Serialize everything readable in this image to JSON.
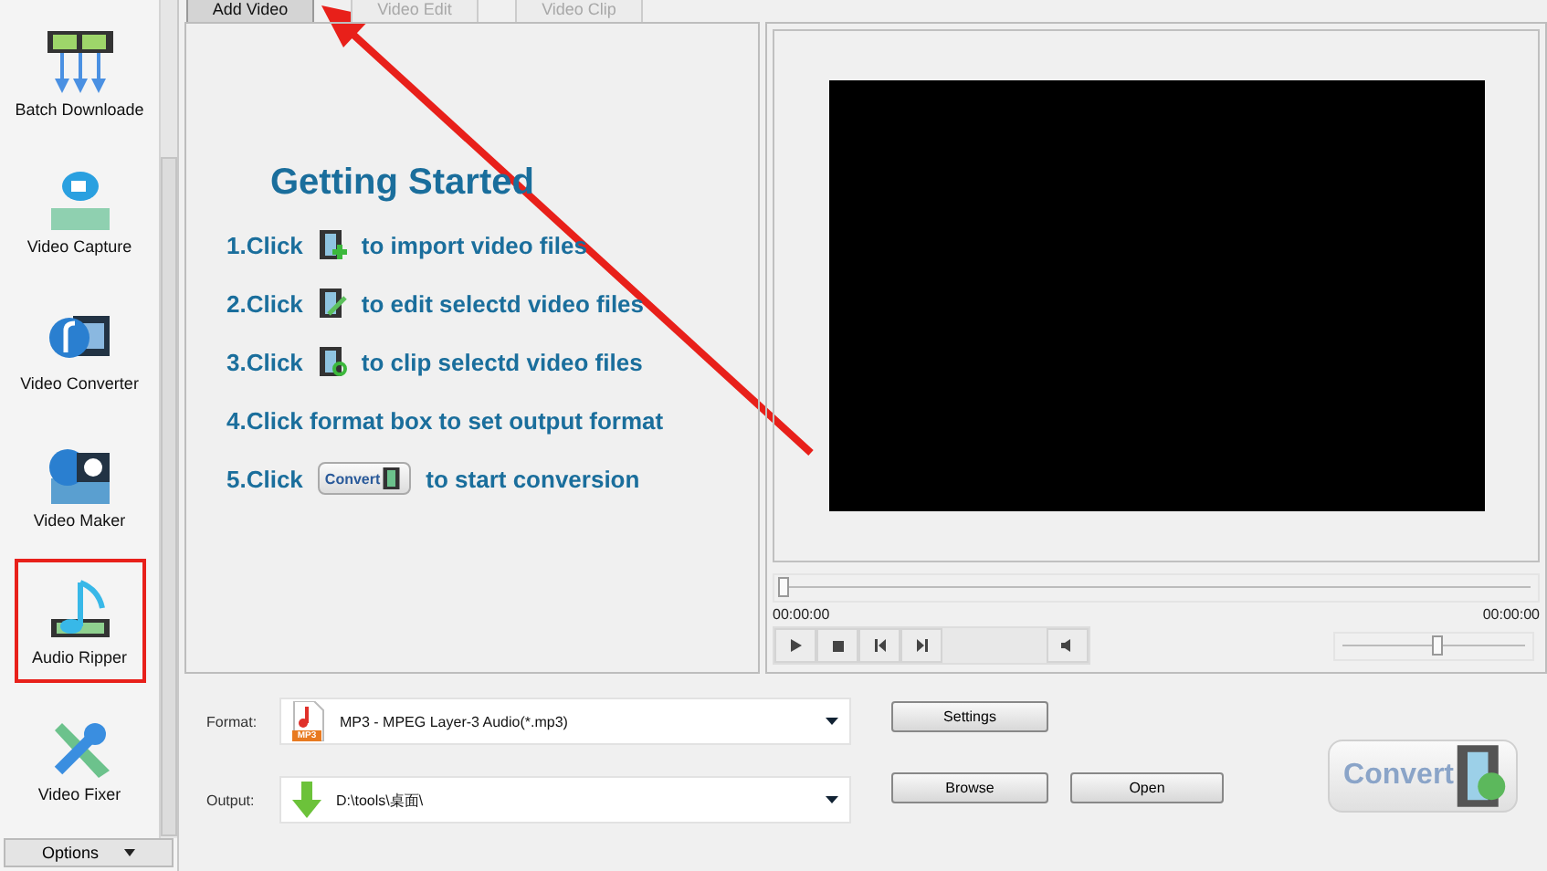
{
  "tabs": [
    {
      "label": "Add Video",
      "selected": true,
      "disabled": false
    },
    {
      "label": "Video Edit",
      "selected": false,
      "disabled": true
    },
    {
      "label": "Video Clip",
      "selected": false,
      "disabled": true
    }
  ],
  "sidebar": {
    "items": [
      {
        "label": "Batch Downloade",
        "highlighted": false
      },
      {
        "label": "Video Capture",
        "highlighted": false
      },
      {
        "label": "Video Converter",
        "highlighted": false
      },
      {
        "label": "Video Maker",
        "highlighted": false
      },
      {
        "label": "Audio Ripper",
        "highlighted": true
      },
      {
        "label": "Video Fixer",
        "highlighted": false
      }
    ],
    "options": "Options"
  },
  "getting_started": {
    "title": "Getting Started",
    "steps": [
      {
        "kind": "icon",
        "lead": "1.Click",
        "rest": "to import video files"
      },
      {
        "kind": "icon",
        "lead": "2.Click",
        "rest": "to edit selectd video files"
      },
      {
        "kind": "icon",
        "lead": "3.Click",
        "rest": "to clip selectd video files"
      },
      {
        "kind": "text",
        "lead": "4.Click format box to set output format"
      },
      {
        "kind": "button",
        "lead": "5.Click",
        "button": "Convert",
        "rest": "to start conversion"
      }
    ]
  },
  "player": {
    "seek": {
      "level": 0
    },
    "time_start": "00:00:00",
    "time_end": "00:00:00",
    "volume": {
      "level": 0.52
    }
  },
  "format": {
    "label": "Format:",
    "value": "MP3 - MPEG Layer-3 Audio(*.mp3)",
    "icon_text": "MP3"
  },
  "output": {
    "label": "Output:",
    "value": "D:\\tools\\桌面\\"
  },
  "buttons": {
    "settings": "Settings",
    "browse": "Browse",
    "open": "Open",
    "convert": "Convert"
  },
  "annotation": {
    "arrow": true
  }
}
